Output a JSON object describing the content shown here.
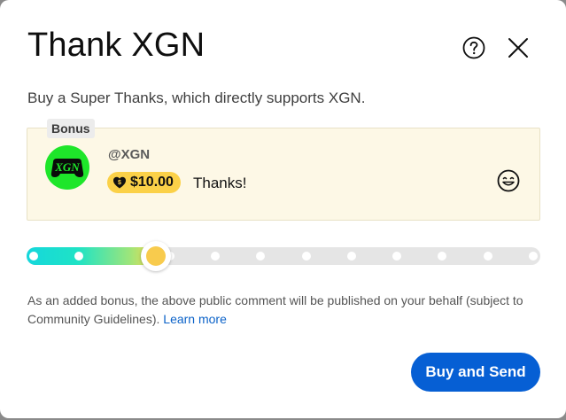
{
  "dialog": {
    "title": "Thank XGN",
    "subtitle": "Buy a Super Thanks, which directly supports XGN."
  },
  "header_icons": {
    "help": "help-circle-icon",
    "close": "close-icon"
  },
  "preview": {
    "bonus_label": "Bonus",
    "channel_name": "@XGN",
    "avatar_text": "XGN",
    "amount": "$10.00",
    "message": "Thanks!",
    "amount_icon": "super-thanks-heart-icon",
    "emoji_icon": "smiley-icon"
  },
  "slider": {
    "steps": 12,
    "selected_step": 3,
    "selected_fraction": 0.2
  },
  "notice": {
    "text": "As an added bonus, the above public comment will be published on your behalf (subject to Community Guidelines).",
    "link_label": "Learn more"
  },
  "actions": {
    "buy_label": "Buy and Send"
  },
  "colors": {
    "accent": "#065fd4",
    "link": "#0b62c8",
    "chip": "#fbd148",
    "preview_bg": "#fdf8e6",
    "avatar_bg": "#1ee62a"
  }
}
